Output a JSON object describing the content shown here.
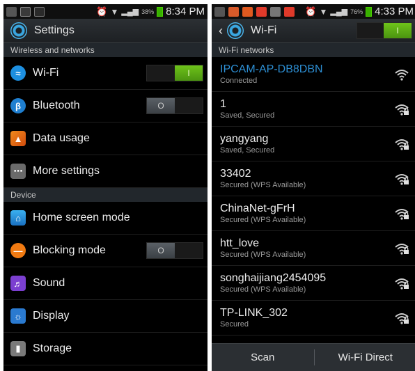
{
  "left": {
    "status": {
      "battery_pct": "38%",
      "time": "8:34 PM"
    },
    "title": "Settings",
    "sections": [
      {
        "header": "Wireless and networks"
      },
      {
        "header": "Device"
      }
    ],
    "rows": [
      {
        "label": "Wi-Fi",
        "icon": "wifi-icon",
        "toggle": "on"
      },
      {
        "label": "Bluetooth",
        "icon": "bluetooth-icon",
        "toggle": "off"
      },
      {
        "label": "Data usage",
        "icon": "data-usage-icon"
      },
      {
        "label": "More settings",
        "icon": "more-icon"
      },
      {
        "label": "Home screen mode",
        "icon": "home-icon"
      },
      {
        "label": "Blocking mode",
        "icon": "blocking-icon",
        "toggle": "off"
      },
      {
        "label": "Sound",
        "icon": "sound-icon"
      },
      {
        "label": "Display",
        "icon": "display-icon"
      },
      {
        "label": "Storage",
        "icon": "storage-icon"
      }
    ],
    "toggle_on_label": "I",
    "toggle_off_label": "O"
  },
  "right": {
    "status": {
      "battery_pct": "76%",
      "time": "4:33 PM"
    },
    "title": "Wi-Fi",
    "section_header": "Wi-Fi networks",
    "networks": [
      {
        "name": "IPCAM-AP-DB8DBN",
        "status": "Connected",
        "secured": false,
        "connected": true
      },
      {
        "name": "1",
        "status": "Saved, Secured",
        "secured": true
      },
      {
        "name": "yangyang",
        "status": "Saved, Secured",
        "secured": true
      },
      {
        "name": "33402",
        "status": "Secured (WPS Available)",
        "secured": true
      },
      {
        "name": "ChinaNet-gFrH",
        "status": "Secured (WPS Available)",
        "secured": true
      },
      {
        "name": "htt_love",
        "status": "Secured (WPS Available)",
        "secured": true
      },
      {
        "name": "songhaijiang2454095",
        "status": "Secured (WPS Available)",
        "secured": true
      },
      {
        "name": "TP-LINK_302",
        "status": "Secured",
        "secured": true
      }
    ],
    "buttons": {
      "scan": "Scan",
      "wifi_direct": "Wi-Fi Direct"
    }
  }
}
